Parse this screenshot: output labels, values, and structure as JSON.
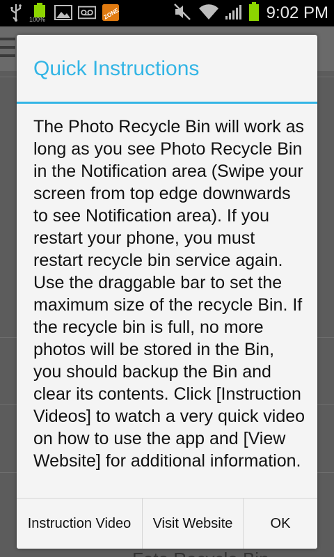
{
  "status_bar": {
    "time": "9:02 PM",
    "battery_label": "100%",
    "icons_left": [
      "usb-icon",
      "battery-full-icon",
      "gallery-icon",
      "voicemail-icon",
      "zone-app-icon"
    ],
    "icons_right": [
      "mute-icon",
      "wifi-icon",
      "signal-icon",
      "battery-icon"
    ],
    "zone_label": "ZONE"
  },
  "background_app": {
    "partial_text": "Foto Recycle Bin"
  },
  "dialog": {
    "title": "Quick Instructions",
    "message": "The Photo Recycle Bin will work as long as you see Photo Recycle Bin in the Notification area (Swipe your screen from top edge downwards to see Notification area). If you restart your phone, you must restart recycle bin service again. Use the draggable bar to set the maximum size of the recycle Bin. If the recycle bin is full, no more photos will be stored in the Bin, you should backup the Bin and clear its contents. Click [Instruction Videos] to watch a very quick video on how to use the app and [View Website] for additional information.",
    "buttons": {
      "instruction_video": "Instruction Video",
      "visit_website": "Visit Website",
      "ok": "OK"
    }
  },
  "colors": {
    "accent": "#33b5e5",
    "battery_green": "#8cd400"
  }
}
